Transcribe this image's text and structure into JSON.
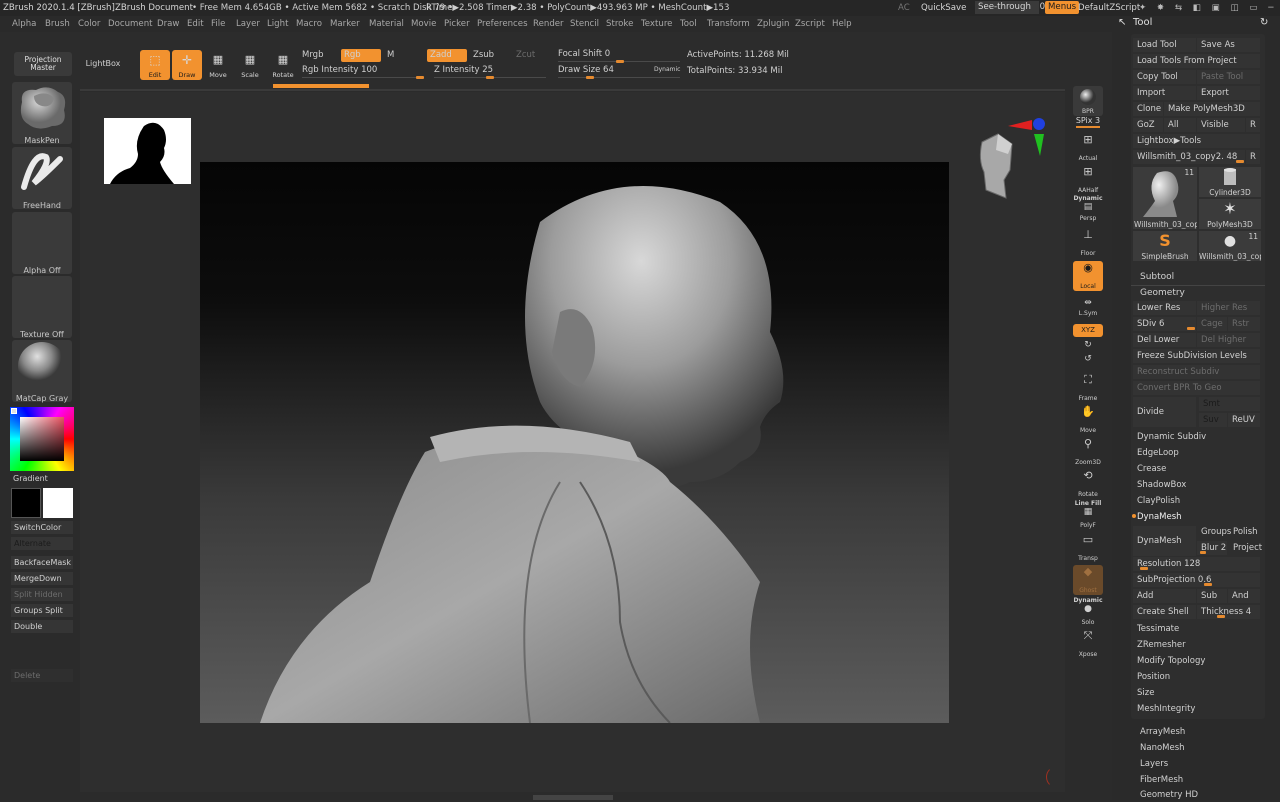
{
  "titlebar": {
    "app": "ZBrush 2020.1.4 [ZBrush]",
    "doc": "ZBrush Document",
    "stats": "• Free Mem 4.654GB • Active Mem 5682 • Scratch Disk 79 •",
    "rtime": "RTime▶2.508 Timer▶2.38 • PolyCount▶493.963 MP • MeshCount▶153",
    "ac": "AC",
    "quicksave": "QuickSave",
    "seethrough": "See-through",
    "seethrough_value": "0",
    "menus": "Menus",
    "default_zscript": "DefaultZScript"
  },
  "menubar": [
    "Alpha",
    "Brush",
    "Color",
    "Document",
    "Draw",
    "Edit",
    "File",
    "Layer",
    "Light",
    "Macro",
    "Marker",
    "Material",
    "Movie",
    "Picker",
    "Preferences",
    "Render",
    "Stencil",
    "Stroke",
    "Texture",
    "Tool",
    "Transform",
    "Zplugin",
    "Zscript",
    "Help"
  ],
  "toolbar": {
    "projection_master": "Projection Master",
    "lightbox": "LightBox",
    "edit": "Edit",
    "draw": "Draw",
    "move": "Move",
    "scale": "Scale",
    "rotate": "Rotate",
    "mrgb": "Mrgb",
    "rgb": "Rgb",
    "m": "M",
    "rgb_intensity": "Rgb Intensity 100",
    "zadd": "Zadd",
    "zsub": "Zsub",
    "zcut": "Zcut",
    "z_intensity": "Z Intensity 25",
    "focal_shift": "Focal Shift 0",
    "draw_size": "Draw Size 64",
    "dynamic": "Dynamic",
    "active_points": "ActivePoints: 11.268 Mil",
    "total_points": "TotalPoints: 33.934 Mil"
  },
  "left": {
    "maskpen": "MaskPen",
    "freehand": "FreeHand",
    "alpha_off": "Alpha Off",
    "texture_off": "Texture Off",
    "matcap": "MatCap Gray",
    "gradient": "Gradient",
    "switchcolor": "SwitchColor",
    "alternate": "Alternate",
    "backfacemask": "BackfaceMask",
    "mergedown": "MergeDown",
    "split_hidden": "Split Hidden",
    "groups_split": "Groups Split",
    "double": "Double",
    "delete": "Delete"
  },
  "rightshelf": {
    "bpr": "BPR",
    "spix": "SPix 3",
    "actual": "Actual",
    "aahalf": "AAHalf",
    "dynamic": "Dynamic",
    "persp": "Persp",
    "floor": "Floor",
    "local": "Local",
    "lsym": "L.Sym",
    "xyz": "XYZ",
    "frame": "Frame",
    "move": "Move",
    "zoom3d": "Zoom3D",
    "rotate": "Rotate",
    "linefill": "Line Fill",
    "polyf": "PolyF",
    "transp": "Transp",
    "ghost": "Ghost",
    "dynamic2": "Dynamic",
    "solo": "Solo",
    "xpose": "Xpose"
  },
  "toolpanel": {
    "title": "Tool",
    "load_tool": "Load Tool",
    "save_as": "Save As",
    "load_from_project": "Load Tools From Project",
    "copy_tool": "Copy Tool",
    "paste_tool": "Paste Tool",
    "import": "Import",
    "export": "Export",
    "clone": "Clone",
    "make_polymesh": "Make PolyMesh3D",
    "goz": "GoZ",
    "all": "All",
    "visible": "Visible",
    "r": "R",
    "lightbox_tools": "Lightbox▶Tools",
    "current_tool": "Willsmith_03_copy2. 48",
    "thumbs": [
      {
        "label": "Willsmith_03_cop",
        "count": "11"
      },
      {
        "label": "Cylinder3D",
        "count": ""
      },
      {
        "label": "PolyMesh3D",
        "count": ""
      },
      {
        "label": "SimpleBrush",
        "count": ""
      },
      {
        "label": "Willsmith_03_cop",
        "count": "11"
      }
    ],
    "subtool": "Subtool",
    "geometry": "Geometry",
    "lower_res": "Lower Res",
    "higher_res": "Higher Res",
    "sdiv": "SDiv 6",
    "cage": "Cage",
    "rstr": "Rstr",
    "del_lower": "Del Lower",
    "del_higher": "Del Higher",
    "freeze": "Freeze SubDivision Levels",
    "reconstruct": "Reconstruct Subdiv",
    "convert_bpr": "Convert BPR To Geo",
    "divide": "Divide",
    "smt": "Smt",
    "suv": "Suv",
    "reuv": "ReUV",
    "dynamic_subdiv": "Dynamic Subdiv",
    "edgeloop": "EdgeLoop",
    "crease": "Crease",
    "shadowbox": "ShadowBox",
    "claypolish": "ClayPolish",
    "dynamesh_header": "DynaMesh",
    "dynamesh": "DynaMesh",
    "groups": "Groups",
    "polish": "Polish",
    "blur": "Blur 2",
    "project": "Project",
    "resolution": "Resolution 128",
    "subprojection": "SubProjection 0.6",
    "add": "Add",
    "sub": "Sub",
    "and": "And",
    "create_shell": "Create Shell",
    "thickness": "Thickness 4",
    "tessimate": "Tessimate",
    "zremesher": "ZRemesher",
    "modify_topology": "Modify Topology",
    "position": "Position",
    "size": "Size",
    "meshintegrity": "MeshIntegrity",
    "arraymesh": "ArrayMesh",
    "nanomesh": "NanoMesh",
    "layers": "Layers",
    "fibermesh": "FiberMesh",
    "geometry_hd": "Geometry HD"
  },
  "colors": {
    "accent": "#f2922f",
    "bg": "#2b2b2b",
    "panel": "#333333"
  }
}
